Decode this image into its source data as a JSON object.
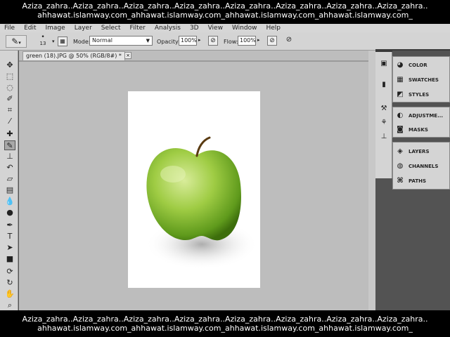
{
  "watermark": {
    "top_line1": "Aziza_zahra..Aziza_zahra..Aziza_zahra..Aziza_zahra..Aziza_zahra..Aziza_zahra..Aziza_zahra..Aziza_zahra..",
    "top_line2": "ahhawat.islamway.com_ahhawat.islamway.com_ahhawat.islamway.com_ahhawat.islamway.com_",
    "bottom_line1": "Aziza_zahra..Aziza_zahra..Aziza_zahra..Aziza_zahra..Aziza_zahra..Aziza_zahra..Aziza_zahra..Aziza_zahra..",
    "bottom_line2": "ahhawat.islamway.com_ahhawat.islamway.com_ahhawat.islamway.com_ahhawat.islamway.com_"
  },
  "menubar": {
    "items": [
      "File",
      "Edit",
      "Image",
      "Layer",
      "Select",
      "Filter",
      "Analysis",
      "3D",
      "View",
      "Window",
      "Help"
    ]
  },
  "options": {
    "brush_size": "13",
    "mode_label": "Mode:",
    "mode_value": "Normal",
    "opacity_label": "Opacity:",
    "opacity_value": "100%",
    "flow_label": "Flow:",
    "flow_value": "100%"
  },
  "document": {
    "tab_title": "green (18).JPG @ 50% (RGB/8#) *",
    "tab_close": "×"
  },
  "panels": {
    "color": "COLOR",
    "swatches": "SWATCHES",
    "styles": "STYLES",
    "adjustments": "ADJUSTME...",
    "masks": "MASKS",
    "layers": "LAYERS",
    "channels": "CHANNELS",
    "paths": "PATHS"
  }
}
